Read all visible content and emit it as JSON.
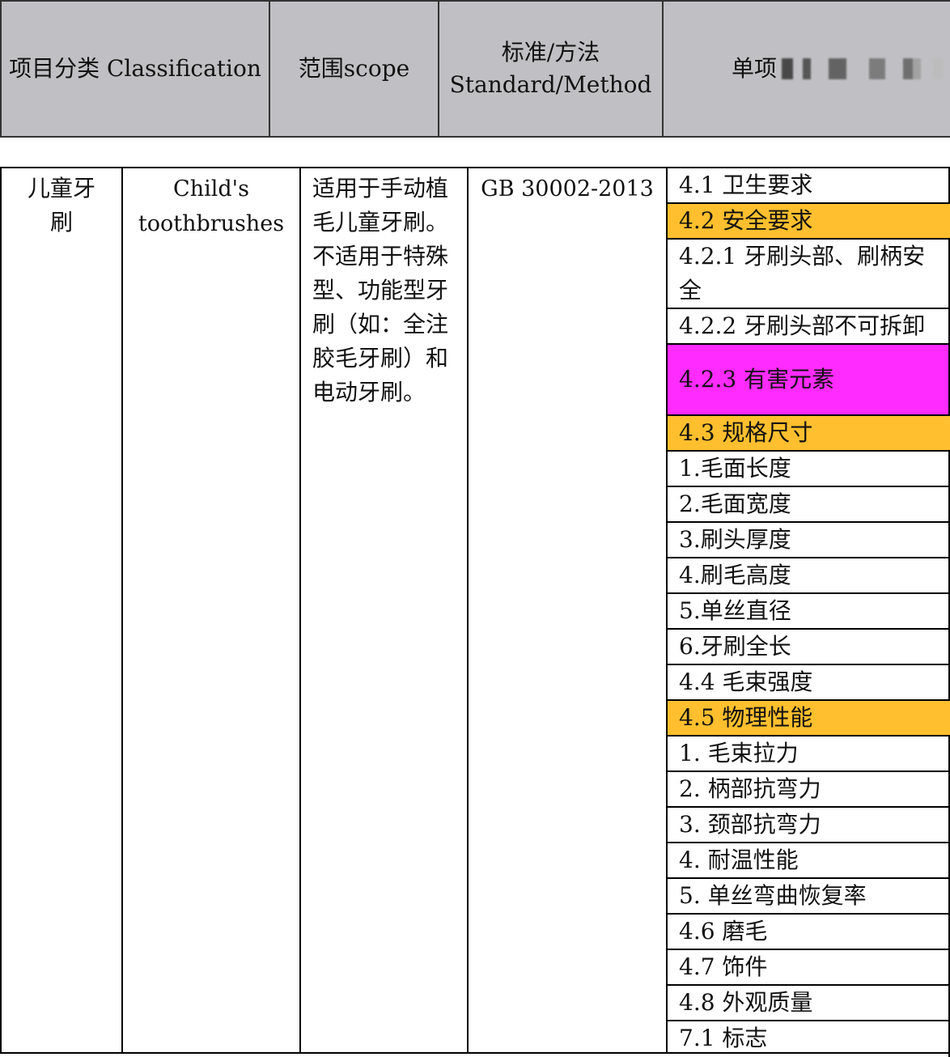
{
  "header": {
    "col1": "项目分类 Classification",
    "col2": "范围scope",
    "col3_line1": "标准/方法",
    "col3_line2": "Standard/Method",
    "col4": "单项"
  },
  "row": {
    "classification_cn": "儿童牙刷",
    "classification_en": "Child's toothbrushes",
    "scope": "适用于手动植毛儿童牙刷。不适用于特殊型、功能型牙刷（如：全注胶毛牙刷）和电动牙刷。",
    "standard": "GB 30002-2013"
  },
  "items": [
    {
      "label": "4.1 卫生要求",
      "style": "plain"
    },
    {
      "label": "4.2 安全要求",
      "style": "highlight-orange"
    },
    {
      "label": "4.2.1 牙刷头部、刷柄安全",
      "style": "tall"
    },
    {
      "label": "4.2.2 牙刷头部不可拆卸",
      "style": "plain"
    },
    {
      "label": "4.2.3 有害元素",
      "style": "highlight-magenta"
    },
    {
      "label": "4.3 规格尺寸",
      "style": "highlight-orange"
    },
    {
      "label": "1.毛面长度",
      "style": "plain"
    },
    {
      "label": "2.毛面宽度",
      "style": "plain"
    },
    {
      "label": "3.刷头厚度",
      "style": "plain"
    },
    {
      "label": "4.刷毛高度",
      "style": "plain"
    },
    {
      "label": "5.单丝直径",
      "style": "plain"
    },
    {
      "label": "6.牙刷全长",
      "style": "plain"
    },
    {
      "label": "4.4 毛束强度",
      "style": "plain"
    },
    {
      "label": "4.5 物理性能",
      "style": "highlight-orange"
    },
    {
      "label": "1. 毛束拉力",
      "style": "plain"
    },
    {
      "label": "2. 柄部抗弯力",
      "style": "plain"
    },
    {
      "label": "3. 颈部抗弯力",
      "style": "plain"
    },
    {
      "label": "4. 耐温性能",
      "style": "plain"
    },
    {
      "label": "5. 单丝弯曲恢复率",
      "style": "plain"
    },
    {
      "label": "4.6 磨毛",
      "style": "plain"
    },
    {
      "label": "4.7 饰件",
      "style": "plain"
    },
    {
      "label": "4.8 外观质量",
      "style": "plain"
    },
    {
      "label": "7.1 标志",
      "style": "plain"
    }
  ],
  "colors": {
    "header_bg": "#c0c0c4",
    "highlight_orange": "#ffbf2e",
    "highlight_magenta": "#ff2bff"
  }
}
